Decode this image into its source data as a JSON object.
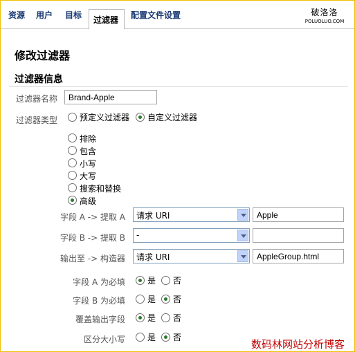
{
  "tabs": [
    {
      "label": "资源"
    },
    {
      "label": "用户"
    },
    {
      "label": "目标"
    },
    {
      "label": "过滤器"
    },
    {
      "label": "配置文件设置"
    }
  ],
  "logo": {
    "title": "破洛洛",
    "subtitle": "POLUOLUO.COM"
  },
  "page_title": "修改过滤器",
  "section_title": "过滤器信息",
  "filter_name": {
    "label": "过滤器名称",
    "value": "Brand-Apple"
  },
  "filter_type": {
    "label": "过滤器类型",
    "options": [
      "预定义过滤器",
      "自定义过滤器"
    ],
    "selected": "自定义过滤器"
  },
  "custom_types": {
    "options": [
      "排除",
      "包含",
      "小写",
      "大写",
      "搜索和替换",
      "高级"
    ],
    "selected": "高级"
  },
  "advanced": {
    "field_a": {
      "label": "字段 A -> 提取 A",
      "select": "请求 URI",
      "value": "Apple"
    },
    "field_b": {
      "label": "字段 B -> 提取 B",
      "select": "-",
      "value": ""
    },
    "output": {
      "label": "输出至 -> 构造器",
      "select": "请求 URI",
      "value": "AppleGroup.html"
    }
  },
  "yes_no": {
    "yes": "是",
    "no": "否"
  },
  "options": [
    {
      "label": "字段 A 为必填",
      "selected": "yes"
    },
    {
      "label": "字段 B 为必填",
      "selected": "no"
    },
    {
      "label": "覆盖输出字段",
      "selected": "yes"
    },
    {
      "label": "区分大小写",
      "selected": "no"
    }
  ],
  "watermark": "数码林网站分析博客"
}
